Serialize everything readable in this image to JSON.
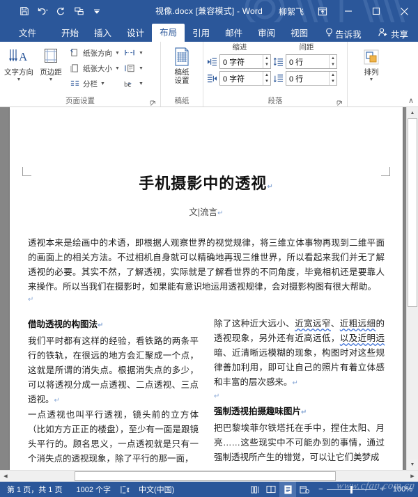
{
  "titlebar": {
    "document_title": "视像.docx [兼容模式] - Word",
    "account_name": "柳絮飞",
    "qat": [
      {
        "name": "save",
        "icon": "save-icon"
      },
      {
        "name": "undo",
        "icon": "undo-icon"
      },
      {
        "name": "redo",
        "icon": "redo-icon"
      },
      {
        "name": "quick-print",
        "icon": "quick-print-icon"
      },
      {
        "name": "customize",
        "icon": "chevron-down-icon"
      }
    ],
    "ribbon_display_options": "ribbon-display-options-icon",
    "minimize": "minimize-icon",
    "maximize": "maximize-icon",
    "close": "close-icon"
  },
  "tabs": [
    {
      "label": "文件",
      "active": false
    },
    {
      "label": "开始",
      "active": false
    },
    {
      "label": "插入",
      "active": false
    },
    {
      "label": "设计",
      "active": false
    },
    {
      "label": "布局",
      "active": true
    },
    {
      "label": "引用",
      "active": false
    },
    {
      "label": "邮件",
      "active": false
    },
    {
      "label": "审阅",
      "active": false
    },
    {
      "label": "视图",
      "active": false
    }
  ],
  "tell_me": "告诉我",
  "share": "共享",
  "ribbon": {
    "groups": [
      {
        "label": "页面设置",
        "has_dialog_launcher": true,
        "big_buttons": [
          {
            "label": "文字方向",
            "icon": "text-direction-icon",
            "dropdown": true
          },
          {
            "label": "页边距",
            "icon": "margins-icon",
            "dropdown": true
          }
        ],
        "small_buttons": [
          {
            "label": "纸张方向",
            "icon": "orientation-icon",
            "dropdown": true
          },
          {
            "label": "纸张大小",
            "icon": "paper-size-icon",
            "dropdown": true
          },
          {
            "label": "分栏",
            "icon": "columns-icon",
            "dropdown": true
          },
          {
            "label": "",
            "icon": "breaks-icon",
            "dropdown": true
          },
          {
            "label": "",
            "icon": "line-numbers-icon",
            "dropdown": true
          },
          {
            "label": "",
            "icon": "hyphenation-icon",
            "dropdown": true
          }
        ]
      },
      {
        "label": "稿纸",
        "has_dialog_launcher": false,
        "big_buttons": [
          {
            "label": "稿纸\n设置",
            "label_line1": "稿纸",
            "label_line2": "设置",
            "icon": "grid-paper-icon",
            "dropdown": false
          }
        ],
        "small_buttons": []
      },
      {
        "label": "段落",
        "has_dialog_launcher": true,
        "sub_headers": [
          "缩进",
          "间距"
        ],
        "fields": [
          {
            "name": "indent-left",
            "icon": "indent-left-icon",
            "value": "0 字符"
          },
          {
            "name": "indent-right",
            "icon": "indent-right-icon",
            "value": "0 字符"
          },
          {
            "name": "spacing-before",
            "icon": "spacing-before-icon",
            "value": "0 行"
          },
          {
            "name": "spacing-after",
            "icon": "spacing-after-icon",
            "value": "0 行"
          }
        ]
      },
      {
        "label": "",
        "has_dialog_launcher": false,
        "big_buttons": [
          {
            "label": "排列",
            "icon": "arrange-icon",
            "dropdown": true
          }
        ],
        "small_buttons": []
      }
    ],
    "collapse_label": "∧"
  },
  "document": {
    "title": "手机摄影中的透视",
    "byline": "文|流言",
    "paragraph_mark": "↵",
    "intro": "透视本来是绘画中的术语，即根据人观察世界的视觉规律，将三维立体事物再现到二维平面的画面上的相关方法。不过相机自身就可以精确地再现三维世界，所以看起来我们并无了解透视的必要。其实不然，了解透视，实际就是了解看世界的不同角度，毕竟相机还是要靠人来操作。所以当我们在摄影时，如果能有意识地运用透视规律，会对摄影构图有很大帮助。",
    "left_column": {
      "heading": "借助透视的构图法",
      "paragraph1": "我们平时都有这样的经验，看铁路的两条平行的铁轨，在很远的地方会汇聚成一个点，这就是所谓的消失点。根据消失点的多少，可以将透视分成一点透视、二点透视、三点透视。",
      "paragraph2": "一点透视也叫平行透视，镜头前的立方体（比如方方正正的楼盘），至少有一面是跟镜头平行的。顾名思义，一点透视就是只有一个消失点的透视现象，除了平行的那一面，"
    },
    "right_column": {
      "paragraph1_a": "除了这种近大远小、",
      "paragraph1_sq1": "近宽远窄",
      "paragraph1_b": "、",
      "paragraph1_sq2": "近粗远细",
      "paragraph1_c": "的透视现象，另外还有近高远低，",
      "paragraph1_sq3": "以及近明远",
      "paragraph1_d": "暗、近清晰远模糊的现象，构图时对这些规律善加利用，即可让自己的照片有着立体感和丰富的层次感来。",
      "heading": "强制透视拍摄趣味图片",
      "paragraph2": "把巴黎埃菲尔铁塔托在手中，捏住太阳、月亮……这些现实中不可能办到的事情，通过强制透视所产生的错觉，可以让它们美梦成"
    }
  },
  "status_bar": {
    "page_info": "第 1 页，共 1 页",
    "word_count": "1002 个字",
    "proofing_icon": "proofing-errors-icon",
    "language": "中文(中国)",
    "macro_icon": "macro-record-icon",
    "views": [
      {
        "name": "read-mode",
        "icon": "read-mode-icon",
        "selected": false
      },
      {
        "name": "print-layout",
        "icon": "print-layout-icon",
        "selected": true
      },
      {
        "name": "web-layout",
        "icon": "web-layout-icon",
        "selected": false
      }
    ],
    "zoom_out": "−",
    "zoom_in": "+",
    "zoom_level": "100%",
    "watermark": "www.cfan.com.cn"
  },
  "colors": {
    "word_blue": "#2b579a",
    "tab_active_bg": "#ffffff",
    "doc_background": "#868686",
    "spellcheck_underline": "#3a6fd8"
  }
}
